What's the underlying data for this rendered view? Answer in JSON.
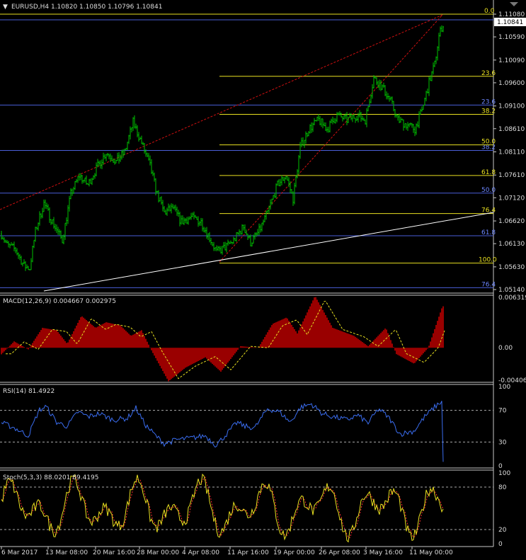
{
  "symbol_header": {
    "arrow": "▼",
    "text": "EURUSD,H4  1.10820 1.10850 1.10796 1.10841"
  },
  "price_panel": {
    "current_price_tag": "1.10841",
    "y_ticks": [
      "1.11080",
      "1.10590",
      "1.10090",
      "1.09600",
      "1.09100",
      "1.08610",
      "1.08110",
      "1.07610",
      "1.07120",
      "1.06620",
      "1.06130",
      "1.05630",
      "1.05140"
    ],
    "fib_yellow_labels": [
      "0.0",
      "23.6",
      "38.2",
      "50.0",
      "61.8",
      "76.4",
      "100.0"
    ],
    "fib_blue_labels": [
      "23.6",
      "38.2",
      "50.0",
      "61.8",
      "76.4"
    ]
  },
  "macd_panel": {
    "title": "MACD(12,26,9) 0.004667 0.002975",
    "y_ticks": [
      "0.006319",
      "0.00",
      "-0.004061"
    ]
  },
  "rsi_panel": {
    "title": "RSI(14) 81.4922",
    "y_ticks": [
      "100",
      "70",
      "30",
      "0"
    ]
  },
  "stoch_panel": {
    "title": "Stoch(5,3,3) 88.0201 89.4195",
    "y_ticks": [
      "100",
      "80",
      "20",
      "0"
    ]
  },
  "time_axis": [
    "6 Mar 2017",
    "13 Mar 08:00",
    "20 Mar 16:00",
    "28 Mar 00:00",
    "4 Apr 08:00",
    "11 Apr 16:00",
    "19 Apr 00:00",
    "26 Apr 08:00",
    "3 May 16:00",
    "11 May 00:00"
  ],
  "colors": {
    "bull": "#00c000",
    "fib_yellow": "#e8e020",
    "fib_blue": "#4a5ed8",
    "macd_hist": "#c00000",
    "macd_signal": "#e8e020",
    "rsi": "#3a6df0",
    "stoch_main": "#e8e020",
    "stoch_signal": "#ff3030",
    "trend_red": "#d01010",
    "trend_white": "#ffffff"
  },
  "chart_data": [
    {
      "type": "line",
      "title": "EURUSD,H4",
      "x": [
        "6 Mar 2017",
        "13 Mar 08:00",
        "20 Mar 16:00",
        "28 Mar 00:00",
        "4 Apr 08:00",
        "11 Apr 16:00",
        "19 Apr 00:00",
        "26 Apr 08:00",
        "3 May 16:00",
        "11 May 00:00"
      ],
      "series": [
        {
          "name": "EURUSD,H4",
          "values": [
            1.057,
            1.0685,
            1.08,
            1.0875,
            1.065,
            1.06,
            1.0725,
            1.089,
            1.086,
            1.105
          ]
        }
      ],
      "ylim": [
        1.0514,
        1.1108
      ],
      "last_bar": {
        "open": 1.1082,
        "high": 1.1085,
        "low": 1.10796,
        "close": 1.10841
      },
      "fib_yellow_levels": [
        1.1108,
        1.0974,
        1.0892,
        1.0826,
        1.076,
        1.0678,
        1.0571
      ],
      "fib_blue_levels": [
        1.0912,
        1.0814,
        1.0722,
        1.063,
        1.0518
      ]
    },
    {
      "type": "bar",
      "title": "MACD(12,26,9)",
      "ylim": [
        -0.004061,
        0.006319
      ],
      "macd": 0.004667,
      "signal": 0.002975
    },
    {
      "type": "line",
      "title": "RSI(14)",
      "ylim": [
        0,
        100
      ],
      "last": 81.4922,
      "levels": [
        70,
        30
      ]
    },
    {
      "type": "line",
      "title": "Stoch(5,3,3)",
      "ylim": [
        0,
        100
      ],
      "main": 88.0201,
      "signal": 89.4195,
      "levels": [
        80,
        20
      ]
    }
  ]
}
